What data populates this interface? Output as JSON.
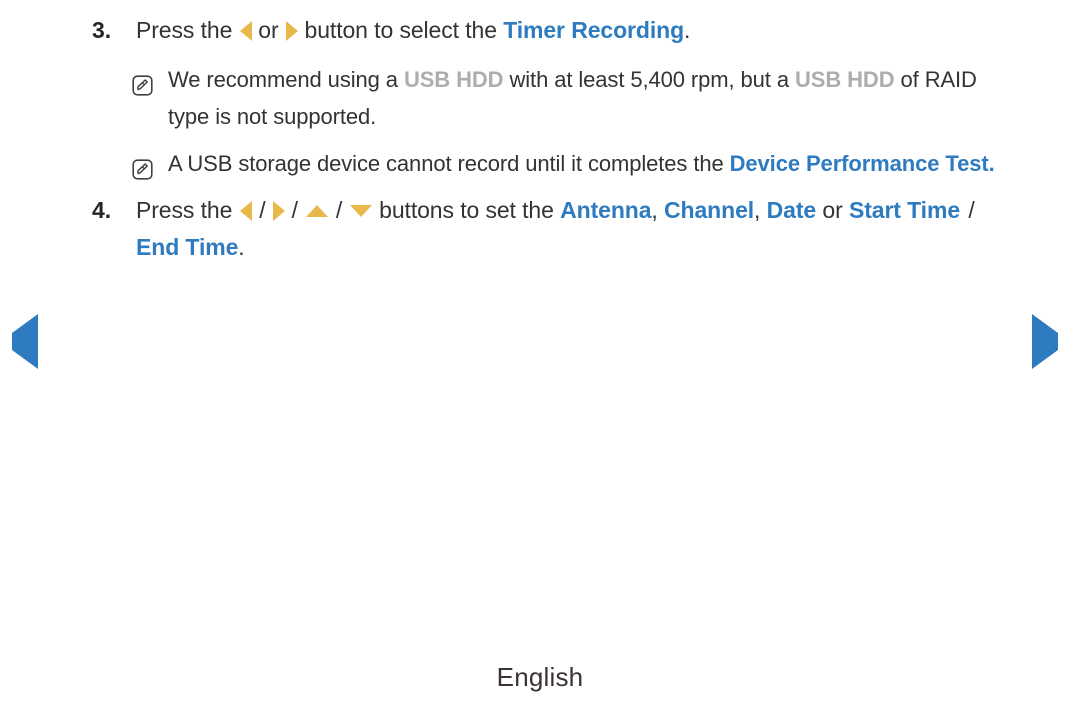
{
  "page": {
    "language_footer": "English",
    "accent_blue": "#2e7bbf",
    "accent_amber": "#e8b84b",
    "muted_gray": "#adadad",
    "body_color": "#333333",
    "background": "#ffffff"
  },
  "steps": [
    {
      "number": "3.",
      "text_before_arrows": "Press the",
      "arrow_left": "left-arrow",
      "conjunction": "or",
      "arrow_right": "right-arrow",
      "text_after_arrows": "button to select the",
      "highlight": "Timer Recording",
      "trailing": "."
    },
    {
      "number": "4.",
      "text_before_arrows": "Press the",
      "arrows": [
        "left-arrow",
        "right-arrow",
        "up-arrow",
        "down-arrow"
      ],
      "separator": "/",
      "text_after_arrows": "buttons to set the",
      "terms": [
        {
          "label": "Antenna",
          "after": ","
        },
        {
          "label": "Channel",
          "after": ","
        },
        {
          "label": "Date",
          "after": " or "
        },
        {
          "label": "Start Time",
          "after": " / "
        },
        {
          "label": "End Time",
          "after": "."
        }
      ]
    }
  ],
  "notes": [
    {
      "icon": "note-pencil-icon",
      "segments": [
        {
          "type": "plain",
          "text": "We recommend using a "
        },
        {
          "type": "gray",
          "text": "USB HDD"
        },
        {
          "type": "plain",
          "text": " with at least 5,400 rpm, but a "
        },
        {
          "type": "gray",
          "text": "USB HDD"
        },
        {
          "type": "plain",
          "text": " of RAID type is not supported."
        }
      ],
      "full_text": "We recommend using a USB HDD with at least 5,400 rpm, but a USB HDD of RAID type is not supported."
    },
    {
      "icon": "note-pencil-icon",
      "segments": [
        {
          "type": "plain",
          "text": "A USB storage device cannot record until it completes the "
        },
        {
          "type": "blue",
          "text": "Device Performance Test"
        },
        {
          "type": "plain",
          "text": "."
        }
      ],
      "full_text": "A USB storage device cannot record until it completes the Device Performance Test."
    }
  ],
  "navigation": {
    "prev_label": "previous-page",
    "next_label": "next-page",
    "prev_icon": "triangle-left-icon",
    "next_icon": "triangle-right-icon"
  },
  "text": {
    "step3_lead": "Press the",
    "step3_or": "or",
    "step3_mid": "button to select the",
    "step3_term": "Timer Recording",
    "step3_end": ".",
    "step4_lead": "Press the",
    "step4_mid": "buttons to set the",
    "term_antenna": "Antenna",
    "term_channel": "Channel",
    "term_date": "Date",
    "term_start_time": "Start Time",
    "term_end_time": "End Time",
    "comma": ",",
    "or_word": "or",
    "slash": "/",
    "period": ".",
    "note1_a": "We recommend using a ",
    "note1_usb1": "USB HDD",
    "note1_b": " with at least 5,400 rpm, but a ",
    "note1_usb2": "USB HDD",
    "note1_c": " of RAID type is not supported.",
    "note2_a": "A USB storage device cannot record until it completes the ",
    "note2_term": "Device Performance Test",
    "note2_b": "."
  }
}
